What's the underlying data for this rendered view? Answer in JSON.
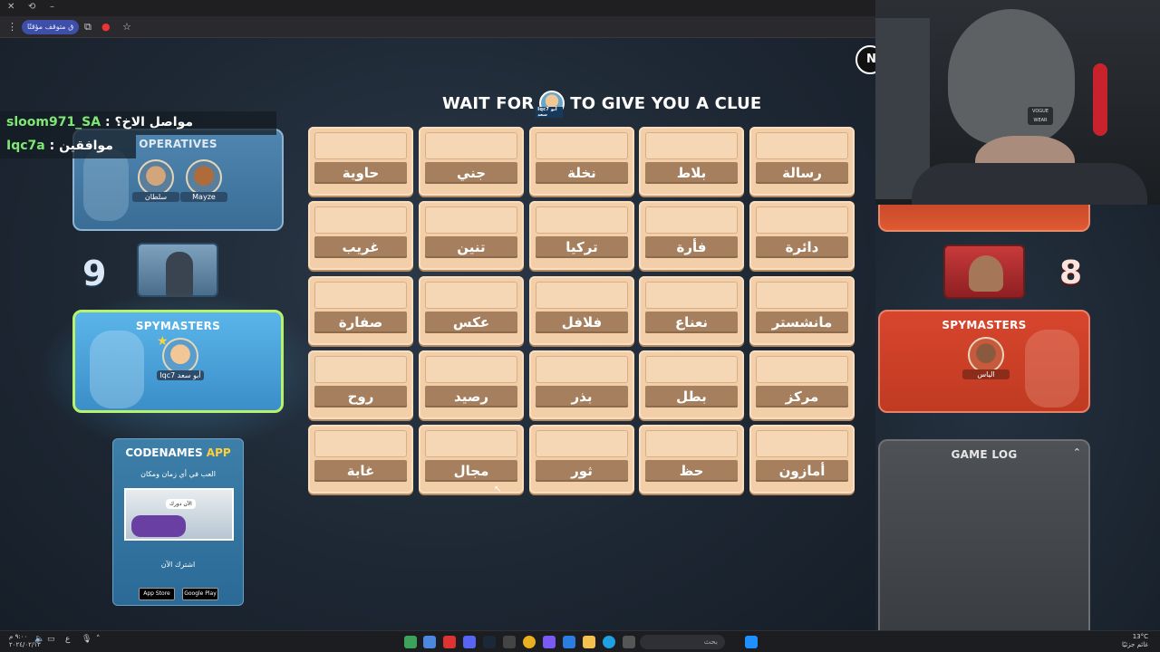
{
  "browser": {
    "paused_chip": "ق متوقف مؤقتًا",
    "window_controls": [
      "✕",
      "–",
      "⟲"
    ]
  },
  "game": {
    "clue_prefix": "WAIT FOR",
    "clue_suffix": "TO GIVE YOU A CLUE",
    "clue_avatar_tag": "Iqc7 أبو سعد",
    "exit_label": "N"
  },
  "board": {
    "cards": [
      [
        "حاوية",
        "جني",
        "نخلة",
        "بلاط",
        "رسالة"
      ],
      [
        "غريب",
        "تنين",
        "تركيا",
        "فأرة",
        "دائرة"
      ],
      [
        "صفارة",
        "عكس",
        "فلافل",
        "نعناع",
        "مانشستر"
      ],
      [
        "روح",
        "رصيد",
        "بذر",
        "بطل",
        "مركز"
      ],
      [
        "غابة",
        "مجال",
        "ثور",
        "حظ",
        "أمازون"
      ]
    ]
  },
  "chat": [
    {
      "user": "sloom971_SA",
      "sep": " : ",
      "message": "مواصل الاخ؟"
    },
    {
      "user": "Iqc7a",
      "sep": " : ",
      "message": "موافقين"
    }
  ],
  "blue_team": {
    "operatives_title": "OPERATIVES",
    "operatives": [
      "سلطان",
      "Mayze"
    ],
    "score": "9",
    "spymasters_title": "SPYMASTERS",
    "spymaster": "Iqc7 أبو سعد"
  },
  "red_team": {
    "score": "8",
    "spymasters_title": "SPYMASTERS",
    "spymaster": "الياس"
  },
  "gamelog": {
    "title": "GAME LOG",
    "toggle_icon": "chevron-up-icon"
  },
  "promo": {
    "title_main": "CODENAMES",
    "title_accent": "APP",
    "subtitle": "العب في أي زمان ومكان",
    "bubble": "الآن دورك",
    "cta": "اشترك الآن",
    "app_store": "App Store",
    "google_play": "Google Play"
  },
  "webcam": {
    "hat_logo": "VOGUE WEAR"
  },
  "taskbar": {
    "search_placeholder": "بحث",
    "clock_time": "٩:٠٠ م",
    "clock_date": "٢٠٢٤/٠٢/١٣",
    "weather_temp": "13°C",
    "weather_desc": "غائم جزئيًا"
  },
  "colors": {
    "card_bg": "#f2cfa8",
    "card_word_strip": "#a6805e",
    "blue_panel": "#4f86b0",
    "blue_spymaster_border": "#b7f26a",
    "red_panel": "#d8452d",
    "chat_user": "#7ee873"
  }
}
